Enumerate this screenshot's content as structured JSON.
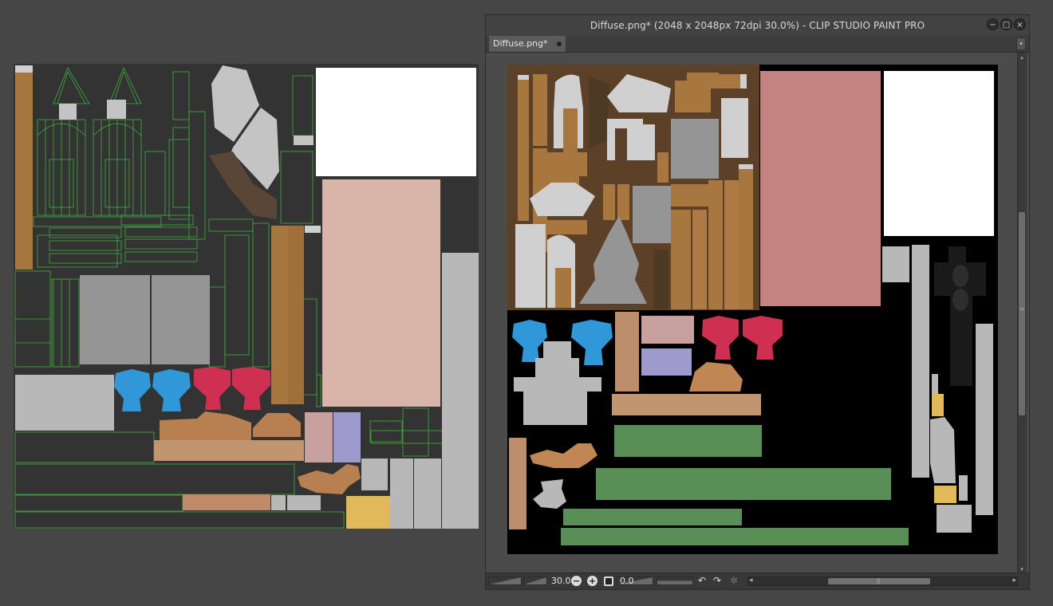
{
  "window": {
    "title": "Diffuse.png* (2048 x 2048px 72dpi 30.0%)  - CLIP STUDIO PAINT PRO",
    "controls": {
      "minimize_glyph": "−",
      "maximize_glyph": "□",
      "close_glyph": "×"
    }
  },
  "tab": {
    "label": "Diffuse.png*"
  },
  "tab_menu": {
    "glyph": "▾"
  },
  "statusbar": {
    "zoom_value": "30.0",
    "zoom_out_glyph": "−",
    "zoom_in_glyph": "+",
    "rotation_value": "0.0",
    "undo_glyph": "↶",
    "redo_glyph": "↷",
    "settings_glyph": "✲",
    "left_glyph": "◂",
    "right_glyph": "▸",
    "grip_glyph": "|||"
  },
  "scroll": {
    "up_glyph": "▴",
    "down_glyph": "▾",
    "grip_glyph": "≡"
  },
  "colors": {
    "app_bg": "#464646",
    "uv_bg": "#333333",
    "wire": "#3fae3f",
    "texture_bg": "#000000",
    "wood": "#a8773f",
    "blue": "#3098d8",
    "red": "#cf2f50",
    "skin": "#d9b4a8",
    "salmon": "#c48381",
    "green": "#5a8e57",
    "gray": "#b8b8b8",
    "yellow": "#e2b95a",
    "lavender": "#9e9acd",
    "pink": "#c9a0a0",
    "tan": "#bd8e6c"
  },
  "icons": [
    "minimize-icon",
    "maximize-icon",
    "close-icon",
    "zoom-out-icon",
    "zoom-in-icon",
    "fit-icon",
    "undo-icon",
    "redo-icon",
    "settings-icon"
  ]
}
